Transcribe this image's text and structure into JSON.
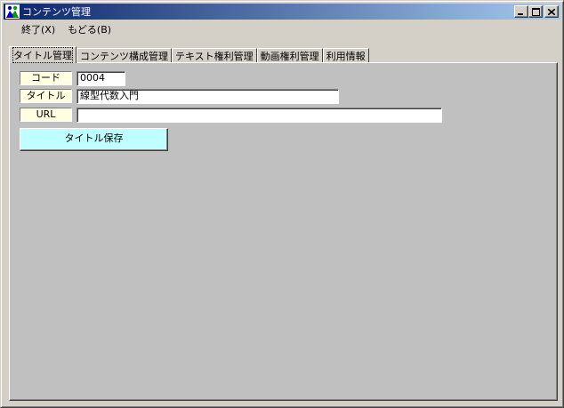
{
  "window": {
    "title": "コンテンツ管理",
    "title_gradient_start": "#0a246a",
    "title_gradient_end": "#a6caf0",
    "icon": "app-people-icon"
  },
  "menubar": {
    "items": [
      {
        "label": "終了(X)"
      },
      {
        "label": "もどる(B)"
      }
    ]
  },
  "tabs": [
    {
      "label": "タイトル管理",
      "active": true
    },
    {
      "label": "コンテンツ構成管理",
      "active": false
    },
    {
      "label": "テキスト権利管理",
      "active": false
    },
    {
      "label": "動画権利管理",
      "active": false
    },
    {
      "label": "利用情報",
      "active": false
    }
  ],
  "form": {
    "code": {
      "label": "コード",
      "value": "0004"
    },
    "title": {
      "label": "タイトル",
      "value": "線型代数入門"
    },
    "url": {
      "label": "URL",
      "value": ""
    },
    "label_bg": "#ffffe1",
    "save_button": {
      "label": "タイトル保存",
      "color": "#c0ffff"
    }
  }
}
